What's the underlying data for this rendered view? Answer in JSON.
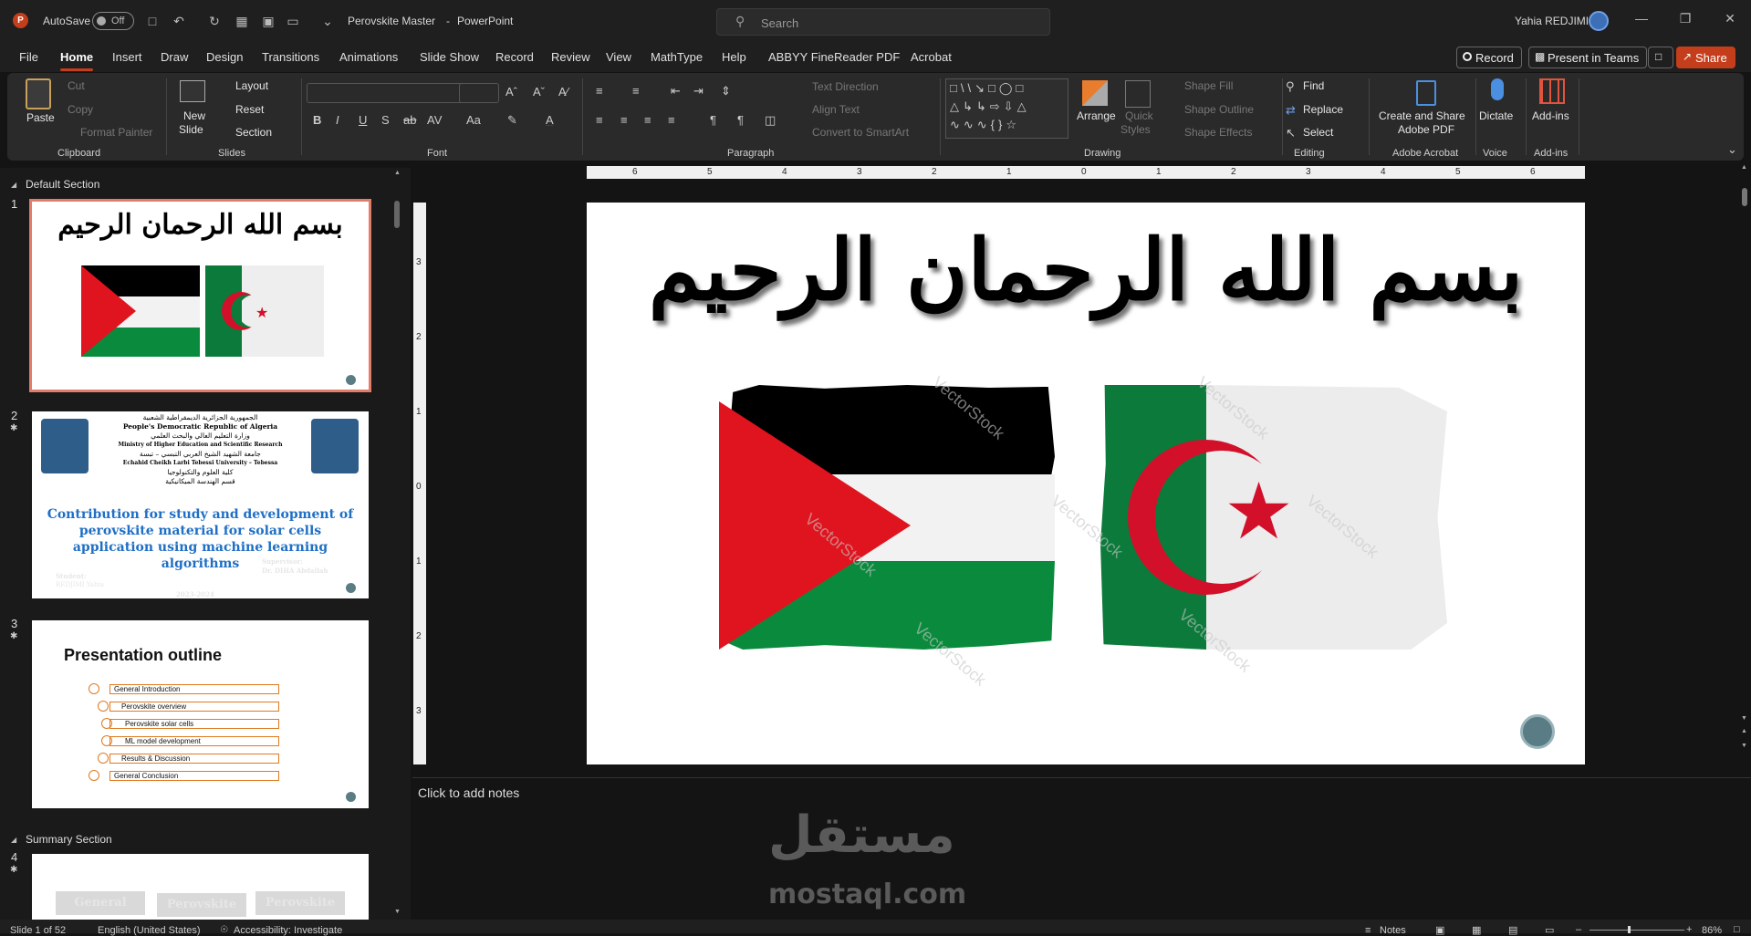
{
  "titlebar": {
    "autosave_label": "AutoSave",
    "autosave_state": "Off",
    "document_title": "Perovskite Master",
    "app_name": "PowerPoint",
    "title_separator": "-",
    "search_placeholder": "Search",
    "user_name": "Yahia REDJIMI"
  },
  "menu": {
    "tabs": [
      "File",
      "Home",
      "Insert",
      "Draw",
      "Design",
      "Transitions",
      "Animations",
      "Slide Show",
      "Record",
      "Review",
      "View",
      "MathType",
      "Help",
      "ABBYY FineReader PDF",
      "Acrobat"
    ],
    "active_tab": "Home",
    "record_btn": "Record",
    "teams_btn": "Present in Teams",
    "share_btn": "Share"
  },
  "ribbon": {
    "clipboard": {
      "paste": "Paste",
      "cut": "Cut",
      "copy": "Copy",
      "format_painter": "Format Painter",
      "group": "Clipboard"
    },
    "slides": {
      "new_slide_1": "New",
      "new_slide_2": "Slide",
      "layout": "Layout",
      "reset": "Reset",
      "section": "Section",
      "group": "Slides"
    },
    "font": {
      "group": "Font",
      "bold": "B",
      "italic": "I",
      "underline": "U",
      "shadow": "S",
      "strike": "ab",
      "spacing": "AV",
      "case": "Aa"
    },
    "paragraph": {
      "text_direction": "Text Direction",
      "align_text": "Align Text",
      "convert_smartart": "Convert to SmartArt",
      "group": "Paragraph"
    },
    "drawing": {
      "arrange": "Arrange",
      "quick_styles_1": "Quick",
      "quick_styles_2": "Styles",
      "shape_fill": "Shape Fill",
      "shape_outline": "Shape Outline",
      "shape_effects": "Shape Effects",
      "group": "Drawing"
    },
    "editing": {
      "find": "Find",
      "replace": "Replace",
      "select": "Select",
      "group": "Editing"
    },
    "acrobat": {
      "create_1": "Create and Share",
      "create_2": "Adobe PDF",
      "group": "Adobe Acrobat"
    },
    "voice": {
      "dictate": "Dictate",
      "group": "Voice"
    },
    "addins": {
      "addins": "Add-ins",
      "group": "Add-ins"
    }
  },
  "thumbnails": {
    "default_section": "Default Section",
    "summary_section": "Summary Section",
    "slide_numbers": [
      "1",
      "2",
      "3",
      "4"
    ],
    "slide1_title": "بسم الله الرحمان الرحيم",
    "slide2": {
      "arabic_1": "الجمهورية الجزائرية الديمقراطية الشعبية",
      "line_1": "People's Democratic Republic of Algeria",
      "arabic_2": "وزارة التعليم العالي والبحث العلمي",
      "line_2": "Ministry of Higher Education and Scientific Research",
      "arabic_3": "جامعة الشهيد الشيخ العربي التبسي – تبسة",
      "line_3": "Echahid Cheikh Larbi Tebessi University – Tebessa",
      "arabic_4": "كلية العلوم والتكنولوجيا",
      "arabic_5": "قسم الهندسة الميكانيكية",
      "title": "Contribution for study and development of perovskite material for solar cells application using machine learning algorithms",
      "supervisor_lbl": "Supervisor:",
      "supervisor": "Dr. DIHA Abdallah",
      "student_lbl": "Student:",
      "student": "REDJIMI Yahia",
      "year": "2023-2024"
    },
    "slide3": {
      "title": "Presentation outline",
      "items": [
        "General Introduction",
        "Perovskite overview",
        "Perovskite solar cells",
        "ML model development",
        "Results & Discussion",
        "General Conclusion"
      ]
    },
    "slide4": {
      "boxes": [
        "General",
        "Perovskite",
        "Perovskite"
      ]
    }
  },
  "slide": {
    "title": "بسم الله الرحمان الرحيم",
    "watermark": "VectorStock",
    "colors": {
      "red": "#e0141e",
      "green": "#0a8a3c",
      "black": "#000000",
      "white": "#f2f2f2",
      "alg_red": "#d2102a",
      "alg_green": "#0b7a3a"
    }
  },
  "ruler": {
    "h_labels": [
      "6",
      "5",
      "4",
      "3",
      "2",
      "1",
      "0",
      "1",
      "2",
      "3",
      "4",
      "5",
      "6"
    ],
    "v_labels": [
      "3",
      "2",
      "1",
      "0",
      "1",
      "2",
      "3"
    ]
  },
  "notes": {
    "placeholder": "Click to add notes"
  },
  "status": {
    "slide_info": "Slide 1 of 52",
    "language": "English (United States)",
    "accessibility": "Accessibility: Investigate",
    "notes": "Notes",
    "zoom": "86%"
  },
  "overlay": {
    "brand_ar": "مستقل",
    "brand_en": "mostaql.com"
  }
}
